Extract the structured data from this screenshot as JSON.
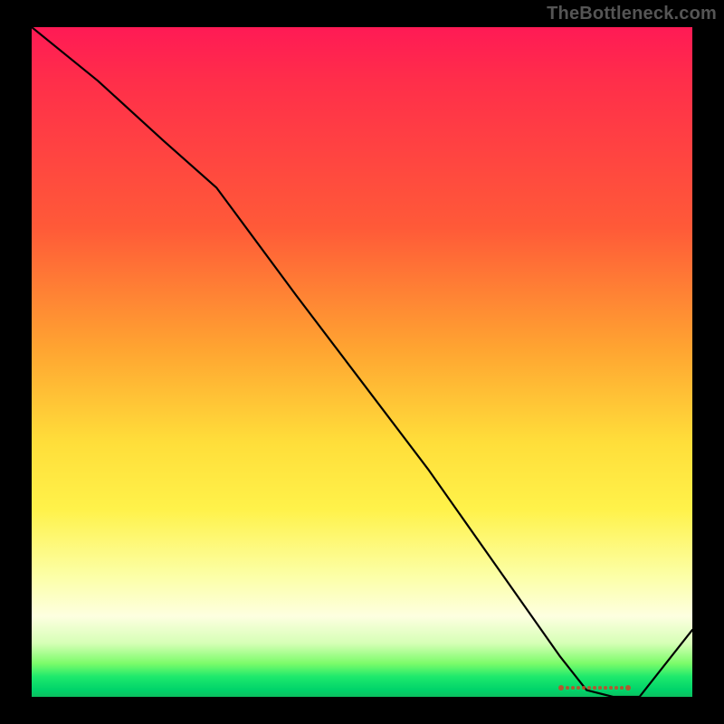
{
  "attribution": "TheBottleneck.com",
  "chart_data": {
    "type": "line",
    "title": "",
    "xlabel": "",
    "ylabel": "",
    "xlim": [
      0,
      100
    ],
    "ylim": [
      0,
      100
    ],
    "x": [
      0,
      10,
      20,
      28,
      40,
      50,
      60,
      70,
      80,
      84,
      88,
      92,
      100
    ],
    "values": [
      100,
      92,
      83,
      76,
      60,
      47,
      34,
      20,
      6,
      1,
      0,
      0,
      10
    ],
    "gradient_stops": [
      {
        "pct": 0,
        "color": "#ff1a55"
      },
      {
        "pct": 30,
        "color": "#ff5a38"
      },
      {
        "pct": 62,
        "color": "#ffde3a"
      },
      {
        "pct": 88,
        "color": "#fdffe0"
      },
      {
        "pct": 97,
        "color": "#1ee96c"
      },
      {
        "pct": 100,
        "color": "#0bbf5f"
      }
    ],
    "highlight_range_x": [
      82,
      92
    ],
    "highlight_color": "#d04225"
  }
}
